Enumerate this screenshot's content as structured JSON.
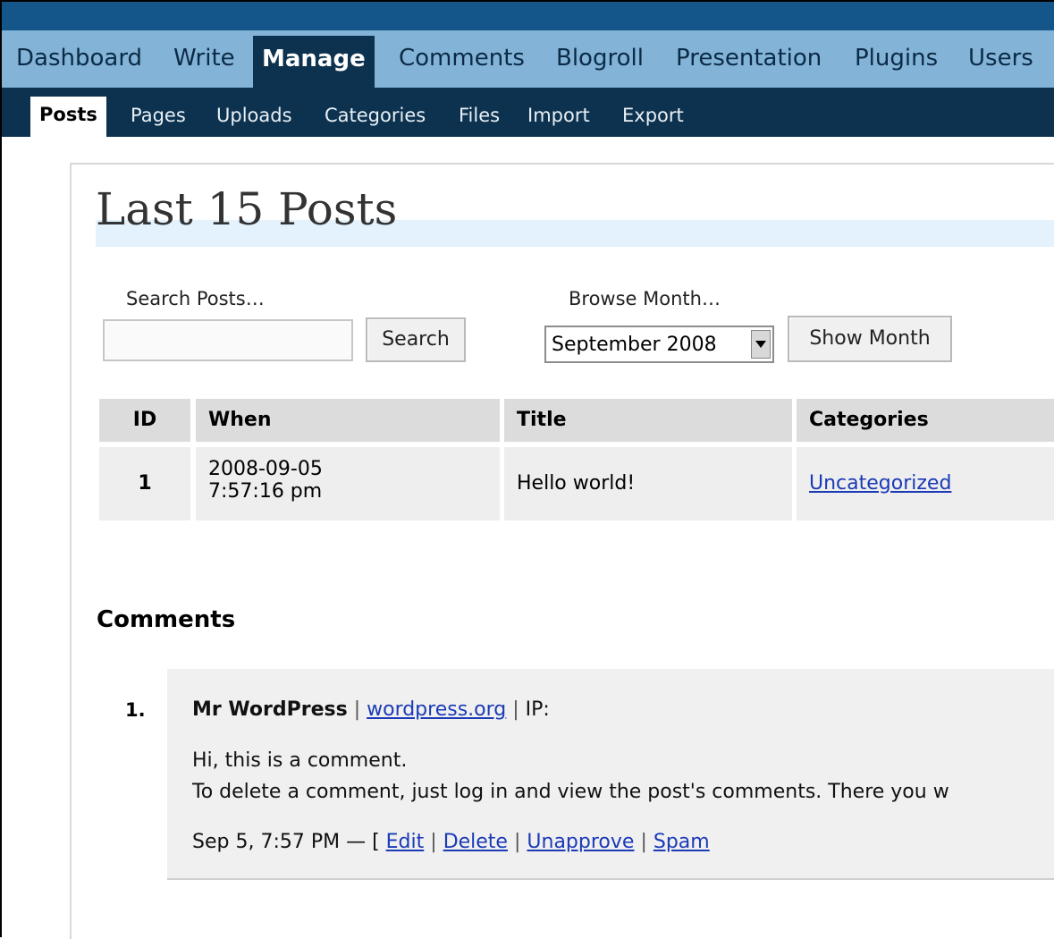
{
  "nav": {
    "main": [
      {
        "label": "Dashboard"
      },
      {
        "label": "Write"
      },
      {
        "label": "Manage",
        "active": true
      },
      {
        "label": "Comments"
      },
      {
        "label": "Blogroll"
      },
      {
        "label": "Presentation"
      },
      {
        "label": "Plugins"
      },
      {
        "label": "Users"
      }
    ],
    "sub": [
      {
        "label": "Posts",
        "active": true
      },
      {
        "label": "Pages"
      },
      {
        "label": "Uploads"
      },
      {
        "label": "Categories"
      },
      {
        "label": "Files"
      },
      {
        "label": "Import"
      },
      {
        "label": "Export"
      }
    ]
  },
  "page": {
    "title": "Last 15 Posts"
  },
  "search": {
    "label": "Search Posts…",
    "value": "",
    "button": "Search"
  },
  "browse": {
    "label": "Browse Month…",
    "selected": "September 2008",
    "button": "Show Month"
  },
  "posts_table": {
    "headers": [
      "ID",
      "When",
      "Title",
      "Categories"
    ],
    "rows": [
      {
        "id": "1",
        "date": "2008-09-05",
        "time": "7:57:16 pm",
        "title": "Hello world!",
        "category": "Uncategorized"
      }
    ]
  },
  "comments": {
    "heading": "Comments",
    "items": [
      {
        "number": "1.",
        "author": "Mr WordPress",
        "url": "wordpress.org",
        "ip_label": "IP:",
        "text_line1": "Hi, this is a comment.",
        "text_line2": "To delete a comment, just log in and view the post's comments. There you w",
        "timestamp": "Sep 5, 7:57 PM — [",
        "actions": {
          "edit": "Edit",
          "delete": "Delete",
          "unapprove": "Unapprove",
          "spam": "Spam"
        }
      }
    ]
  },
  "colors": {
    "top_strip": "#14568a",
    "main_nav_bg": "#83b4d8",
    "sub_nav_bg": "#0d324f",
    "link": "#1b3ab6",
    "title_bar": "#e4f2fd"
  }
}
